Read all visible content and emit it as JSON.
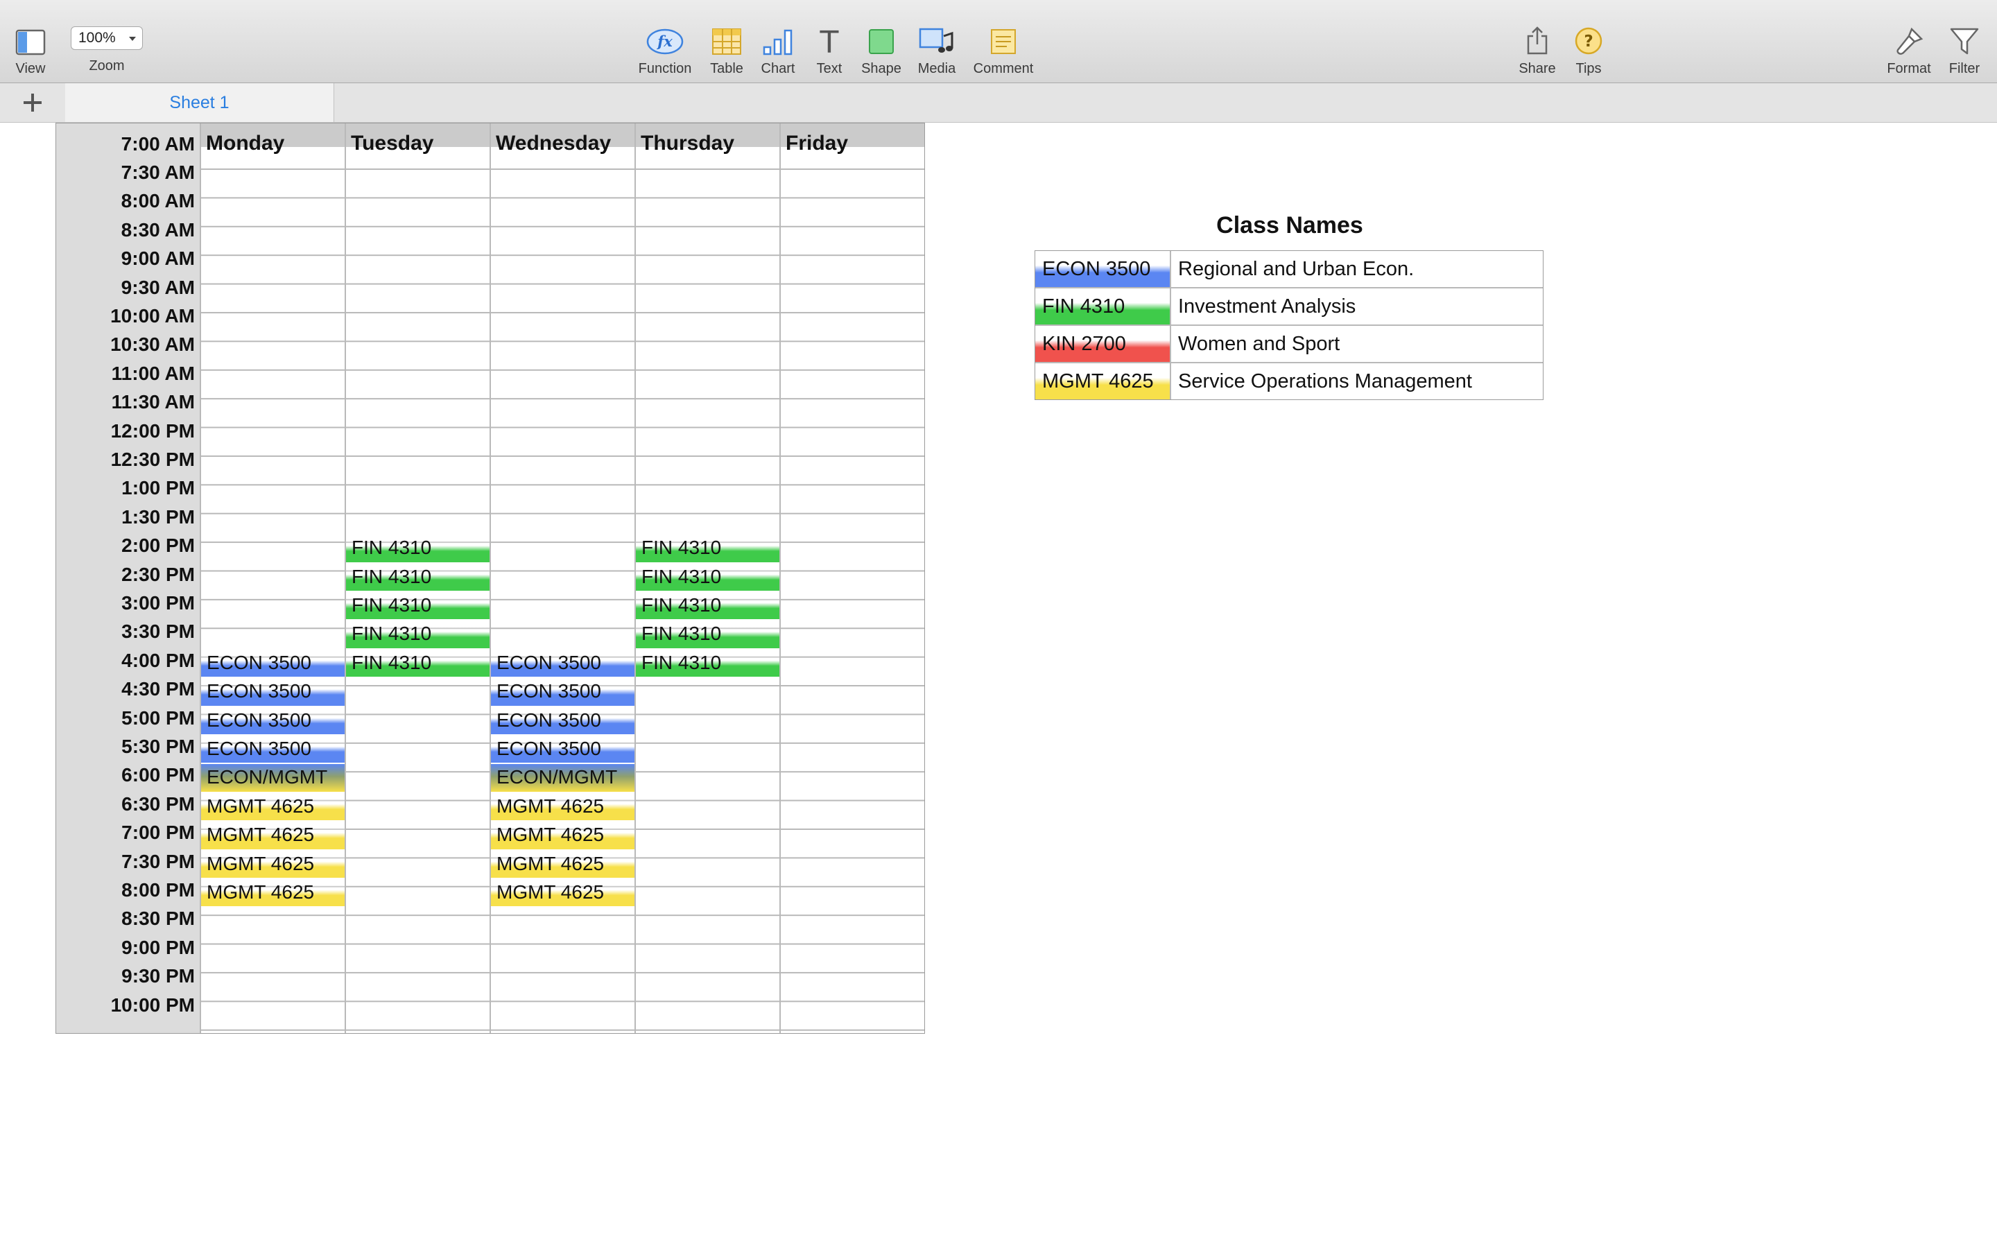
{
  "toolbar": {
    "left": [
      {
        "label": "View",
        "icon": "view-icon"
      }
    ],
    "zoom": {
      "value": "100%",
      "label": "Zoom"
    },
    "insert": [
      {
        "label": "Function",
        "icon": "function-icon",
        "glyph": "fx"
      },
      {
        "label": "Table",
        "icon": "table-icon"
      },
      {
        "label": "Chart",
        "icon": "chart-icon"
      },
      {
        "label": "Text",
        "icon": "text-icon",
        "glyph": "T"
      },
      {
        "label": "Shape",
        "icon": "shape-icon"
      },
      {
        "label": "Media",
        "icon": "media-icon"
      },
      {
        "label": "Comment",
        "icon": "comment-icon"
      }
    ],
    "right": [
      {
        "label": "Share",
        "icon": "share-icon"
      },
      {
        "label": "Tips",
        "icon": "tips-icon",
        "glyph": "?"
      }
    ],
    "far_right": [
      {
        "label": "Format",
        "icon": "format-brush-icon"
      },
      {
        "label": "Filter",
        "icon": "filter-icon"
      }
    ]
  },
  "sheet_tabs": {
    "add_icon": "plus-icon",
    "tabs": [
      {
        "label": "Sheet 1",
        "active": true
      }
    ]
  },
  "schedule": {
    "days": [
      "Monday",
      "Tuesday",
      "Wednesday",
      "Thursday",
      "Friday"
    ],
    "times": [
      "7:00 AM",
      "7:30 AM",
      "8:00 AM",
      "8:30 AM",
      "9:00 AM",
      "9:30 AM",
      "10:00 AM",
      "10:30 AM",
      "11:00 AM",
      "11:30 AM",
      "12:00 PM",
      "12:30 PM",
      "1:00 PM",
      "1:30 PM",
      "2:00 PM",
      "2:30 PM",
      "3:00 PM",
      "3:30 PM",
      "4:00 PM",
      "4:30 PM",
      "5:00 PM",
      "5:30 PM",
      "6:00 PM",
      "6:30 PM",
      "7:00 PM",
      "7:30 PM",
      "8:00 PM",
      "8:30 PM",
      "9:00 PM",
      "9:30 PM",
      "10:00 PM"
    ],
    "cells": [
      {
        "day": 1,
        "time": 14,
        "text": "FIN 4310",
        "class": "fin"
      },
      {
        "day": 1,
        "time": 15,
        "text": "FIN 4310",
        "class": "fin"
      },
      {
        "day": 1,
        "time": 16,
        "text": "FIN 4310",
        "class": "fin"
      },
      {
        "day": 1,
        "time": 17,
        "text": "FIN 4310",
        "class": "fin"
      },
      {
        "day": 1,
        "time": 18,
        "text": "FIN 4310",
        "class": "fin"
      },
      {
        "day": 3,
        "time": 14,
        "text": "FIN 4310",
        "class": "fin"
      },
      {
        "day": 3,
        "time": 15,
        "text": "FIN 4310",
        "class": "fin"
      },
      {
        "day": 3,
        "time": 16,
        "text": "FIN 4310",
        "class": "fin"
      },
      {
        "day": 3,
        "time": 17,
        "text": "FIN 4310",
        "class": "fin"
      },
      {
        "day": 3,
        "time": 18,
        "text": "FIN 4310",
        "class": "fin"
      },
      {
        "day": 0,
        "time": 18,
        "text": "ECON 3500",
        "class": "econ"
      },
      {
        "day": 0,
        "time": 19,
        "text": "ECON 3500",
        "class": "econ"
      },
      {
        "day": 0,
        "time": 20,
        "text": "ECON 3500",
        "class": "econ"
      },
      {
        "day": 0,
        "time": 21,
        "text": "ECON 3500",
        "class": "econ"
      },
      {
        "day": 0,
        "time": 22,
        "text": "ECON/MGMT",
        "class": "econmgmt"
      },
      {
        "day": 0,
        "time": 23,
        "text": "MGMT 4625",
        "class": "mgmt"
      },
      {
        "day": 0,
        "time": 24,
        "text": "MGMT 4625",
        "class": "mgmt"
      },
      {
        "day": 0,
        "time": 25,
        "text": "MGMT 4625",
        "class": "mgmt"
      },
      {
        "day": 0,
        "time": 26,
        "text": "MGMT 4625",
        "class": "mgmt"
      },
      {
        "day": 2,
        "time": 18,
        "text": "ECON 3500",
        "class": "econ"
      },
      {
        "day": 2,
        "time": 19,
        "text": "ECON 3500",
        "class": "econ"
      },
      {
        "day": 2,
        "time": 20,
        "text": "ECON 3500",
        "class": "econ"
      },
      {
        "day": 2,
        "time": 21,
        "text": "ECON 3500",
        "class": "econ"
      },
      {
        "day": 2,
        "time": 22,
        "text": "ECON/MGMT",
        "class": "econmgmt"
      },
      {
        "day": 2,
        "time": 23,
        "text": "MGMT 4625",
        "class": "mgmt"
      },
      {
        "day": 2,
        "time": 24,
        "text": "MGMT 4625",
        "class": "mgmt"
      },
      {
        "day": 2,
        "time": 25,
        "text": "MGMT 4625",
        "class": "mgmt"
      },
      {
        "day": 2,
        "time": 26,
        "text": "MGMT 4625",
        "class": "mgmt"
      }
    ]
  },
  "legend": {
    "title": "Class Names",
    "rows": [
      {
        "code": "ECON 3500",
        "name": "Regional and Urban Econ.",
        "class": "econ"
      },
      {
        "code": "FIN 4310",
        "name": "Investment Analysis",
        "class": "fin"
      },
      {
        "code": "KIN 2700",
        "name": "Women and Sport",
        "class": "kin"
      },
      {
        "code": "MGMT 4625",
        "name": "Service Operations Management",
        "class": "mgmt"
      }
    ]
  },
  "colors": {
    "econ": "#5b86f2",
    "fin": "#3fcb4a",
    "kin": "#f0524d",
    "mgmt": "#f7e04a",
    "accent": "#2a7ee0"
  }
}
